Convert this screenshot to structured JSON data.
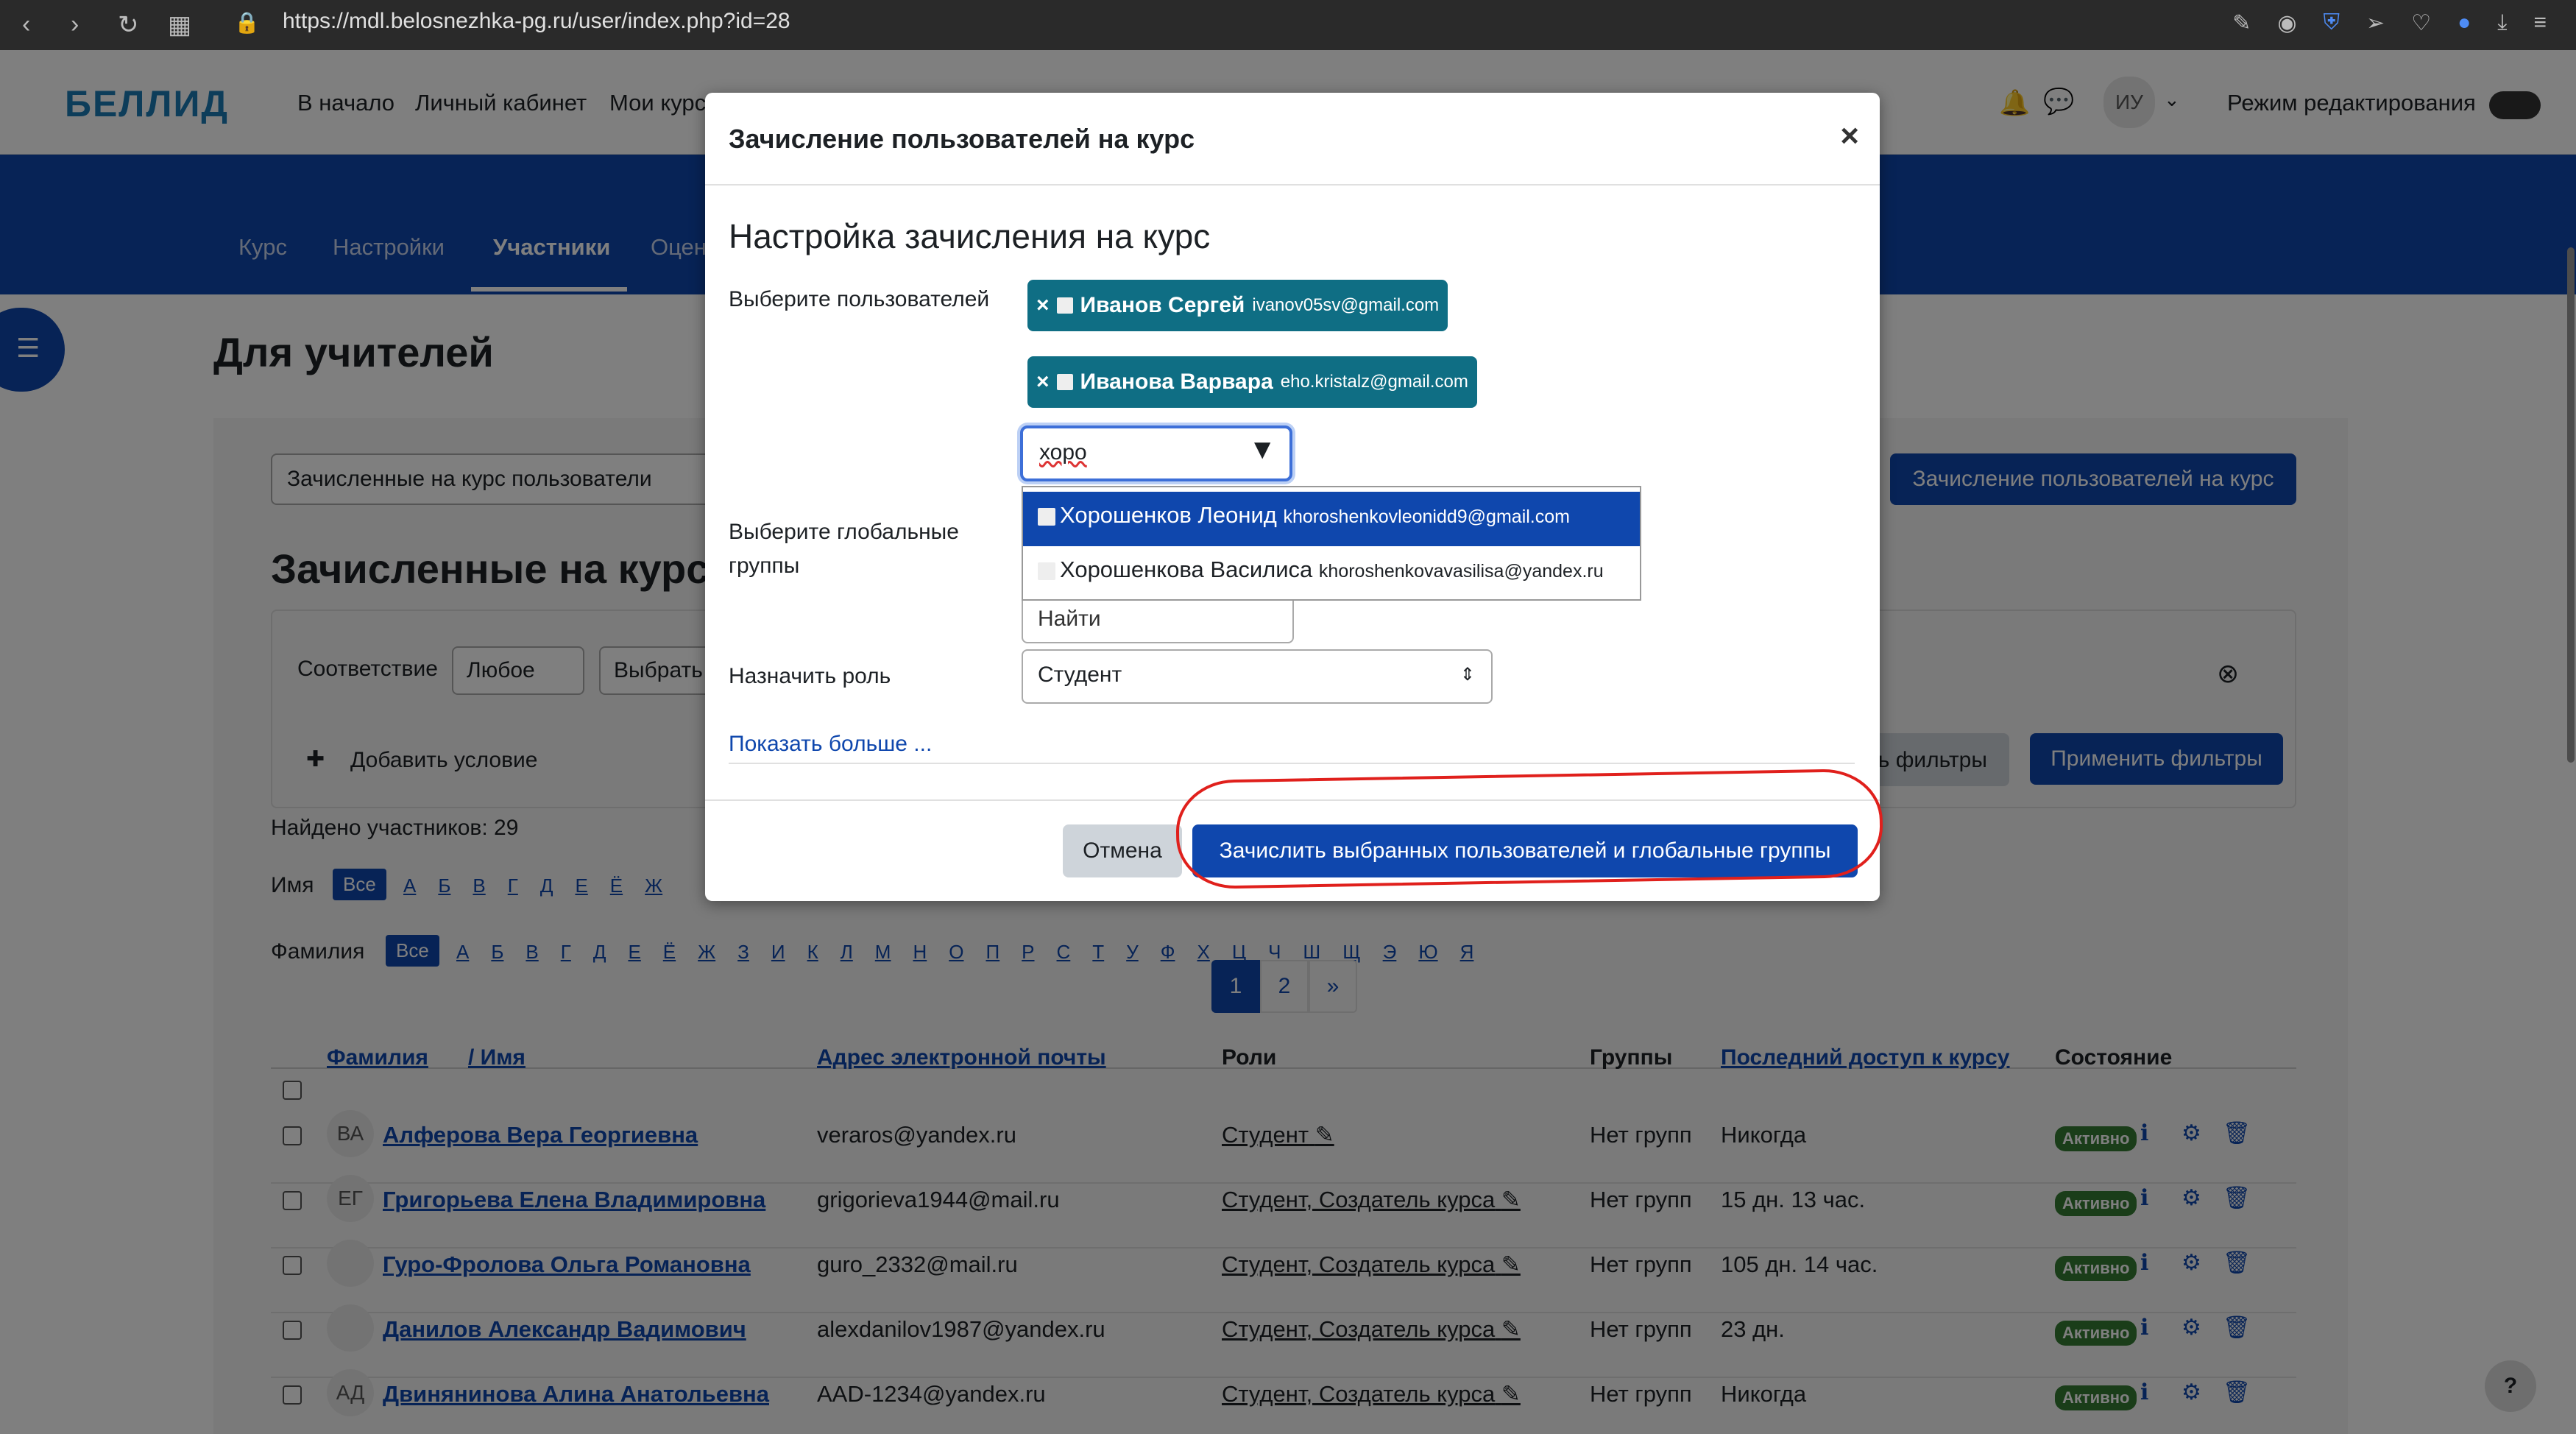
{
  "browser": {
    "url": "https://mdl.belosnezhka-pg.ru/user/index.php?id=28"
  },
  "site": {
    "logo": "БЕЛЛИД",
    "nav": [
      "В начало",
      "Личный кабинет",
      "Мои курсы"
    ],
    "user_initials": "ИУ",
    "edit_mode_label": "Режим редактирования"
  },
  "course_tabs": [
    "Курс",
    "Настройки",
    "Участники",
    "Оценки"
  ],
  "page": {
    "title": "Для учителей",
    "enrolled_select": "Зачисленные на курс пользователи",
    "enroll_button": "Зачисление пользователей на курс",
    "section_title": "Зачисленные на курс",
    "filter": {
      "match_label": "Соответствие",
      "match_value": "Любое",
      "choose": "Выбрать",
      "add_condition": "Добавить условие",
      "clear_filters": "ть фильтры",
      "apply_filters": "Применить фильтры"
    },
    "found": "Найдено участников: 29",
    "first_name_label": "Имя",
    "last_name_label": "Фамилия",
    "all_label": "Все",
    "letters_first": [
      "А",
      "Б",
      "В",
      "Г",
      "Д",
      "Е",
      "Ё",
      "Ж"
    ],
    "letters_last": [
      "А",
      "Б",
      "В",
      "Г",
      "Д",
      "Е",
      "Ё",
      "Ж",
      "З",
      "И",
      "К",
      "Л",
      "М",
      "Н",
      "О",
      "П",
      "Р",
      "С",
      "Т",
      "У",
      "Ф",
      "Х",
      "Ц",
      "Ч",
      "Ш",
      "Щ",
      "Э",
      "Ю",
      "Я"
    ],
    "pages": [
      "1",
      "2",
      "»"
    ],
    "columns": {
      "lastname": "Фамилия",
      "firstname": "/ Имя",
      "email": "Адрес электронной почты",
      "roles": "Роли",
      "groups": "Группы",
      "last_access": "Последний доступ к курсу",
      "status": "Состояние"
    },
    "rows": [
      {
        "initials": "ВА",
        "name": "Алферова Вера Георгиевна",
        "email": "veraros@yandex.ru",
        "roles": "Студент",
        "groups": "Нет групп",
        "access": "Никогда",
        "status": "Активно"
      },
      {
        "initials": "ЕГ",
        "name": "Григорьева Елена Владимировна",
        "email": "grigorieva1944@mail.ru",
        "roles": "Студент, Создатель курса",
        "groups": "Нет групп",
        "access": "15 дн. 13 час.",
        "status": "Активно"
      },
      {
        "initials": "",
        "name": "Гуро-Фролова Ольга Романовна",
        "email": "guro_2332@mail.ru",
        "roles": "Студент, Создатель курса",
        "groups": "Нет групп",
        "access": "105 дн. 14 час.",
        "status": "Активно"
      },
      {
        "initials": "",
        "name": "Данилов Александр Вадимович",
        "email": "alexdanilov1987@yandex.ru",
        "roles": "Студент, Создатель курса",
        "groups": "Нет групп",
        "access": "23 дн.",
        "status": "Активно"
      },
      {
        "initials": "АД",
        "name": "Двинянинова Алина Анатольевна",
        "email": "AAD-1234@yandex.ru",
        "roles": "Студент, Создатель курса",
        "groups": "Нет групп",
        "access": "Никогда",
        "status": "Активно"
      }
    ]
  },
  "modal": {
    "title": "Зачисление пользователей на курс",
    "section_heading": "Настройка зачисления на курс",
    "select_users_label": "Выберите пользователей",
    "selected_users": [
      {
        "name": "Иванов Сергей",
        "email": "ivanov05sv@gmail.com"
      },
      {
        "name": "Иванова Варвара",
        "email": "eho.kristalz@gmail.com"
      }
    ],
    "search_value": "хоро",
    "suggestions": [
      {
        "name": "Хорошенков Леонид",
        "email": "khoroshenkovleonidd9@gmail.com"
      },
      {
        "name": "Хорошенкова Василиса",
        "email": "khoroshenkovavasilisa@yandex.ru"
      }
    ],
    "global_groups_label": "Выберите глобальные группы",
    "global_groups_placeholder": "Найти",
    "role_label": "Назначить роль",
    "role_value": "Студент",
    "show_more": "Показать больше ...",
    "cancel": "Отмена",
    "submit": "Зачислить выбранных пользователей и глобальные группы"
  }
}
